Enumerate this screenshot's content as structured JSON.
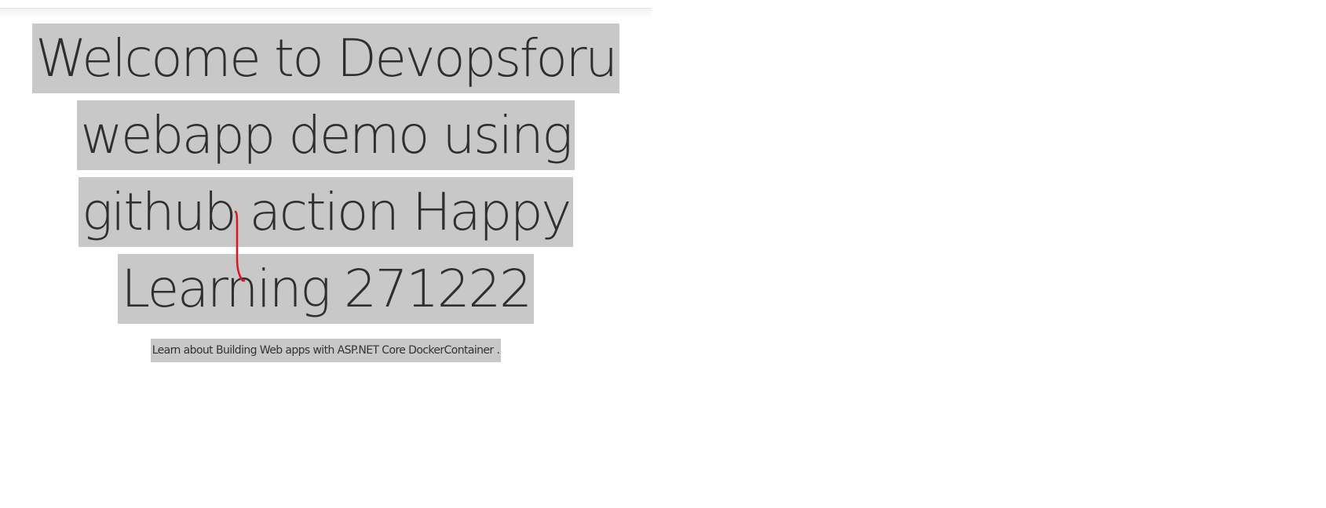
{
  "page": {
    "heading": "Welcome to Devopsforu webapp demo using github action Happy Learning 271222",
    "lead_prefix": "Learn about ",
    "lead_link": "Building Web apps with ASP.NET Core DockerContainer",
    "lead_suffix": " ."
  },
  "colors": {
    "highlight": "#c8c8c8",
    "annotation": "#e0141e"
  }
}
